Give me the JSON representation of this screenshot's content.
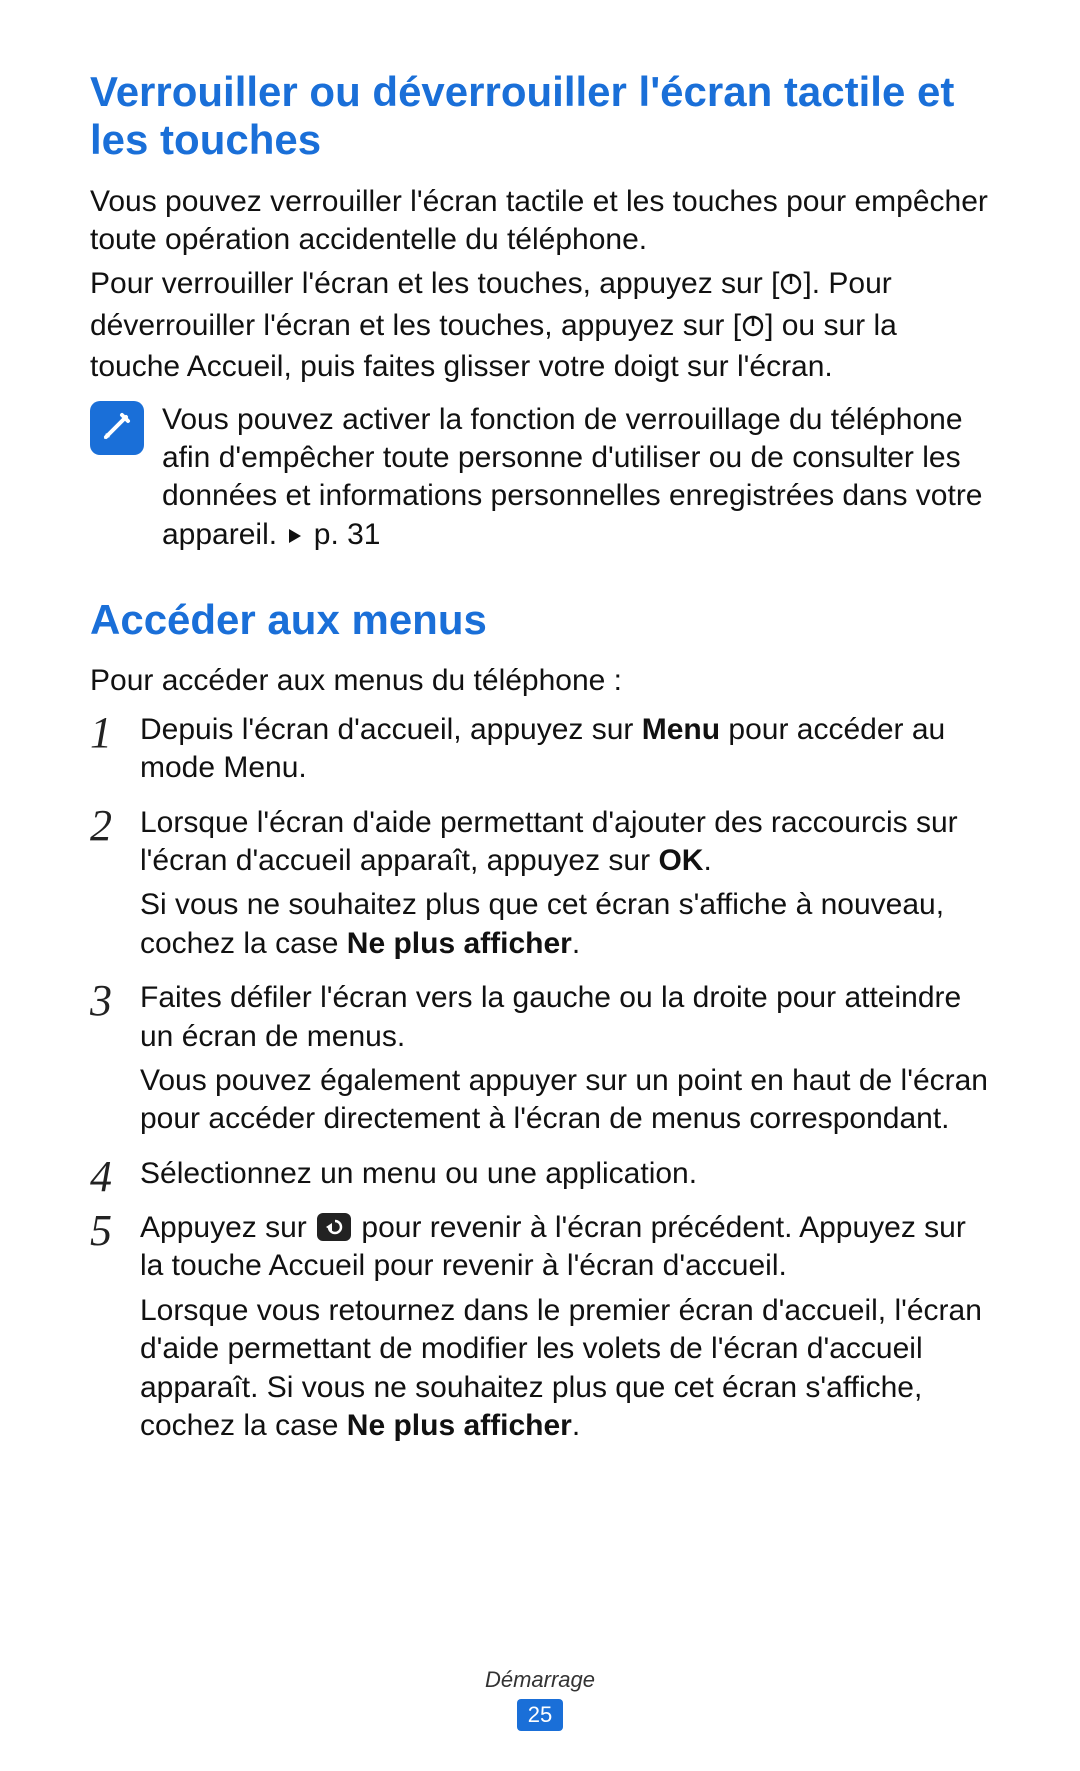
{
  "colors": {
    "accent": "#1a6fd8"
  },
  "section1": {
    "heading": "Verrouiller ou déverrouiller l'écran tactile et les touches",
    "p1": "Vous pouvez verrouiller l'écran tactile et les touches pour empêcher toute opération accidentelle du téléphone.",
    "p2a": "Pour verrouiller l'écran et les touches, appuyez sur [",
    "p2b": "]. Pour déverrouiller l'écran et les touches, appuyez sur [",
    "p2c": "] ou sur la touche Accueil, puis faites glisser votre doigt sur l'écran."
  },
  "note": {
    "text_a": "Vous pouvez activer la fonction de verrouillage du téléphone afin d'empêcher toute personne d'utiliser ou de consulter les données et informations personnelles enregistrées dans votre appareil. ",
    "text_b": " p. 31"
  },
  "section2": {
    "heading": "Accéder aux menus",
    "intro": "Pour accéder aux menus du téléphone :",
    "steps": [
      {
        "n": "1",
        "parts": [
          {
            "t": "Depuis l'écran d'accueil, appuyez sur "
          },
          {
            "t": "Menu",
            "bold": true
          },
          {
            "t": " pour accéder au mode Menu."
          }
        ]
      },
      {
        "n": "2",
        "parts": [
          {
            "t": "Lorsque l'écran d'aide permettant d'ajouter des raccourcis sur l'écran d'accueil apparaît, appuyez sur "
          },
          {
            "t": "OK",
            "bold": true
          },
          {
            "t": "."
          }
        ],
        "extra_parts": [
          {
            "t": "Si vous ne souhaitez plus que cet écran s'affiche à nouveau, cochez la case "
          },
          {
            "t": "Ne plus afficher",
            "bold": true
          },
          {
            "t": "."
          }
        ]
      },
      {
        "n": "3",
        "parts": [
          {
            "t": "Faites défiler l'écran vers la gauche ou la droite pour atteindre un écran de menus."
          }
        ],
        "extra_parts": [
          {
            "t": "Vous pouvez également appuyer sur un point en haut de l'écran pour accéder directement à l'écran de menus correspondant."
          }
        ]
      },
      {
        "n": "4",
        "parts": [
          {
            "t": "Sélectionnez un menu ou une application."
          }
        ]
      },
      {
        "n": "5",
        "parts": [
          {
            "t": "Appuyez sur "
          },
          {
            "icon": "back-key"
          },
          {
            "t": " pour revenir à l'écran précédent. Appuyez sur la touche Accueil pour revenir à l'écran d'accueil."
          }
        ],
        "extra_parts": [
          {
            "t": "Lorsque vous retournez dans le premier écran d'accueil, l'écran d'aide permettant de modifier les volets de l'écran d'accueil apparaît. Si vous ne souhaitez plus que cet écran s'affiche, cochez la case "
          },
          {
            "t": "Ne plus afficher",
            "bold": true
          },
          {
            "t": "."
          }
        ]
      }
    ]
  },
  "footer": {
    "section": "Démarrage",
    "page": "25"
  }
}
